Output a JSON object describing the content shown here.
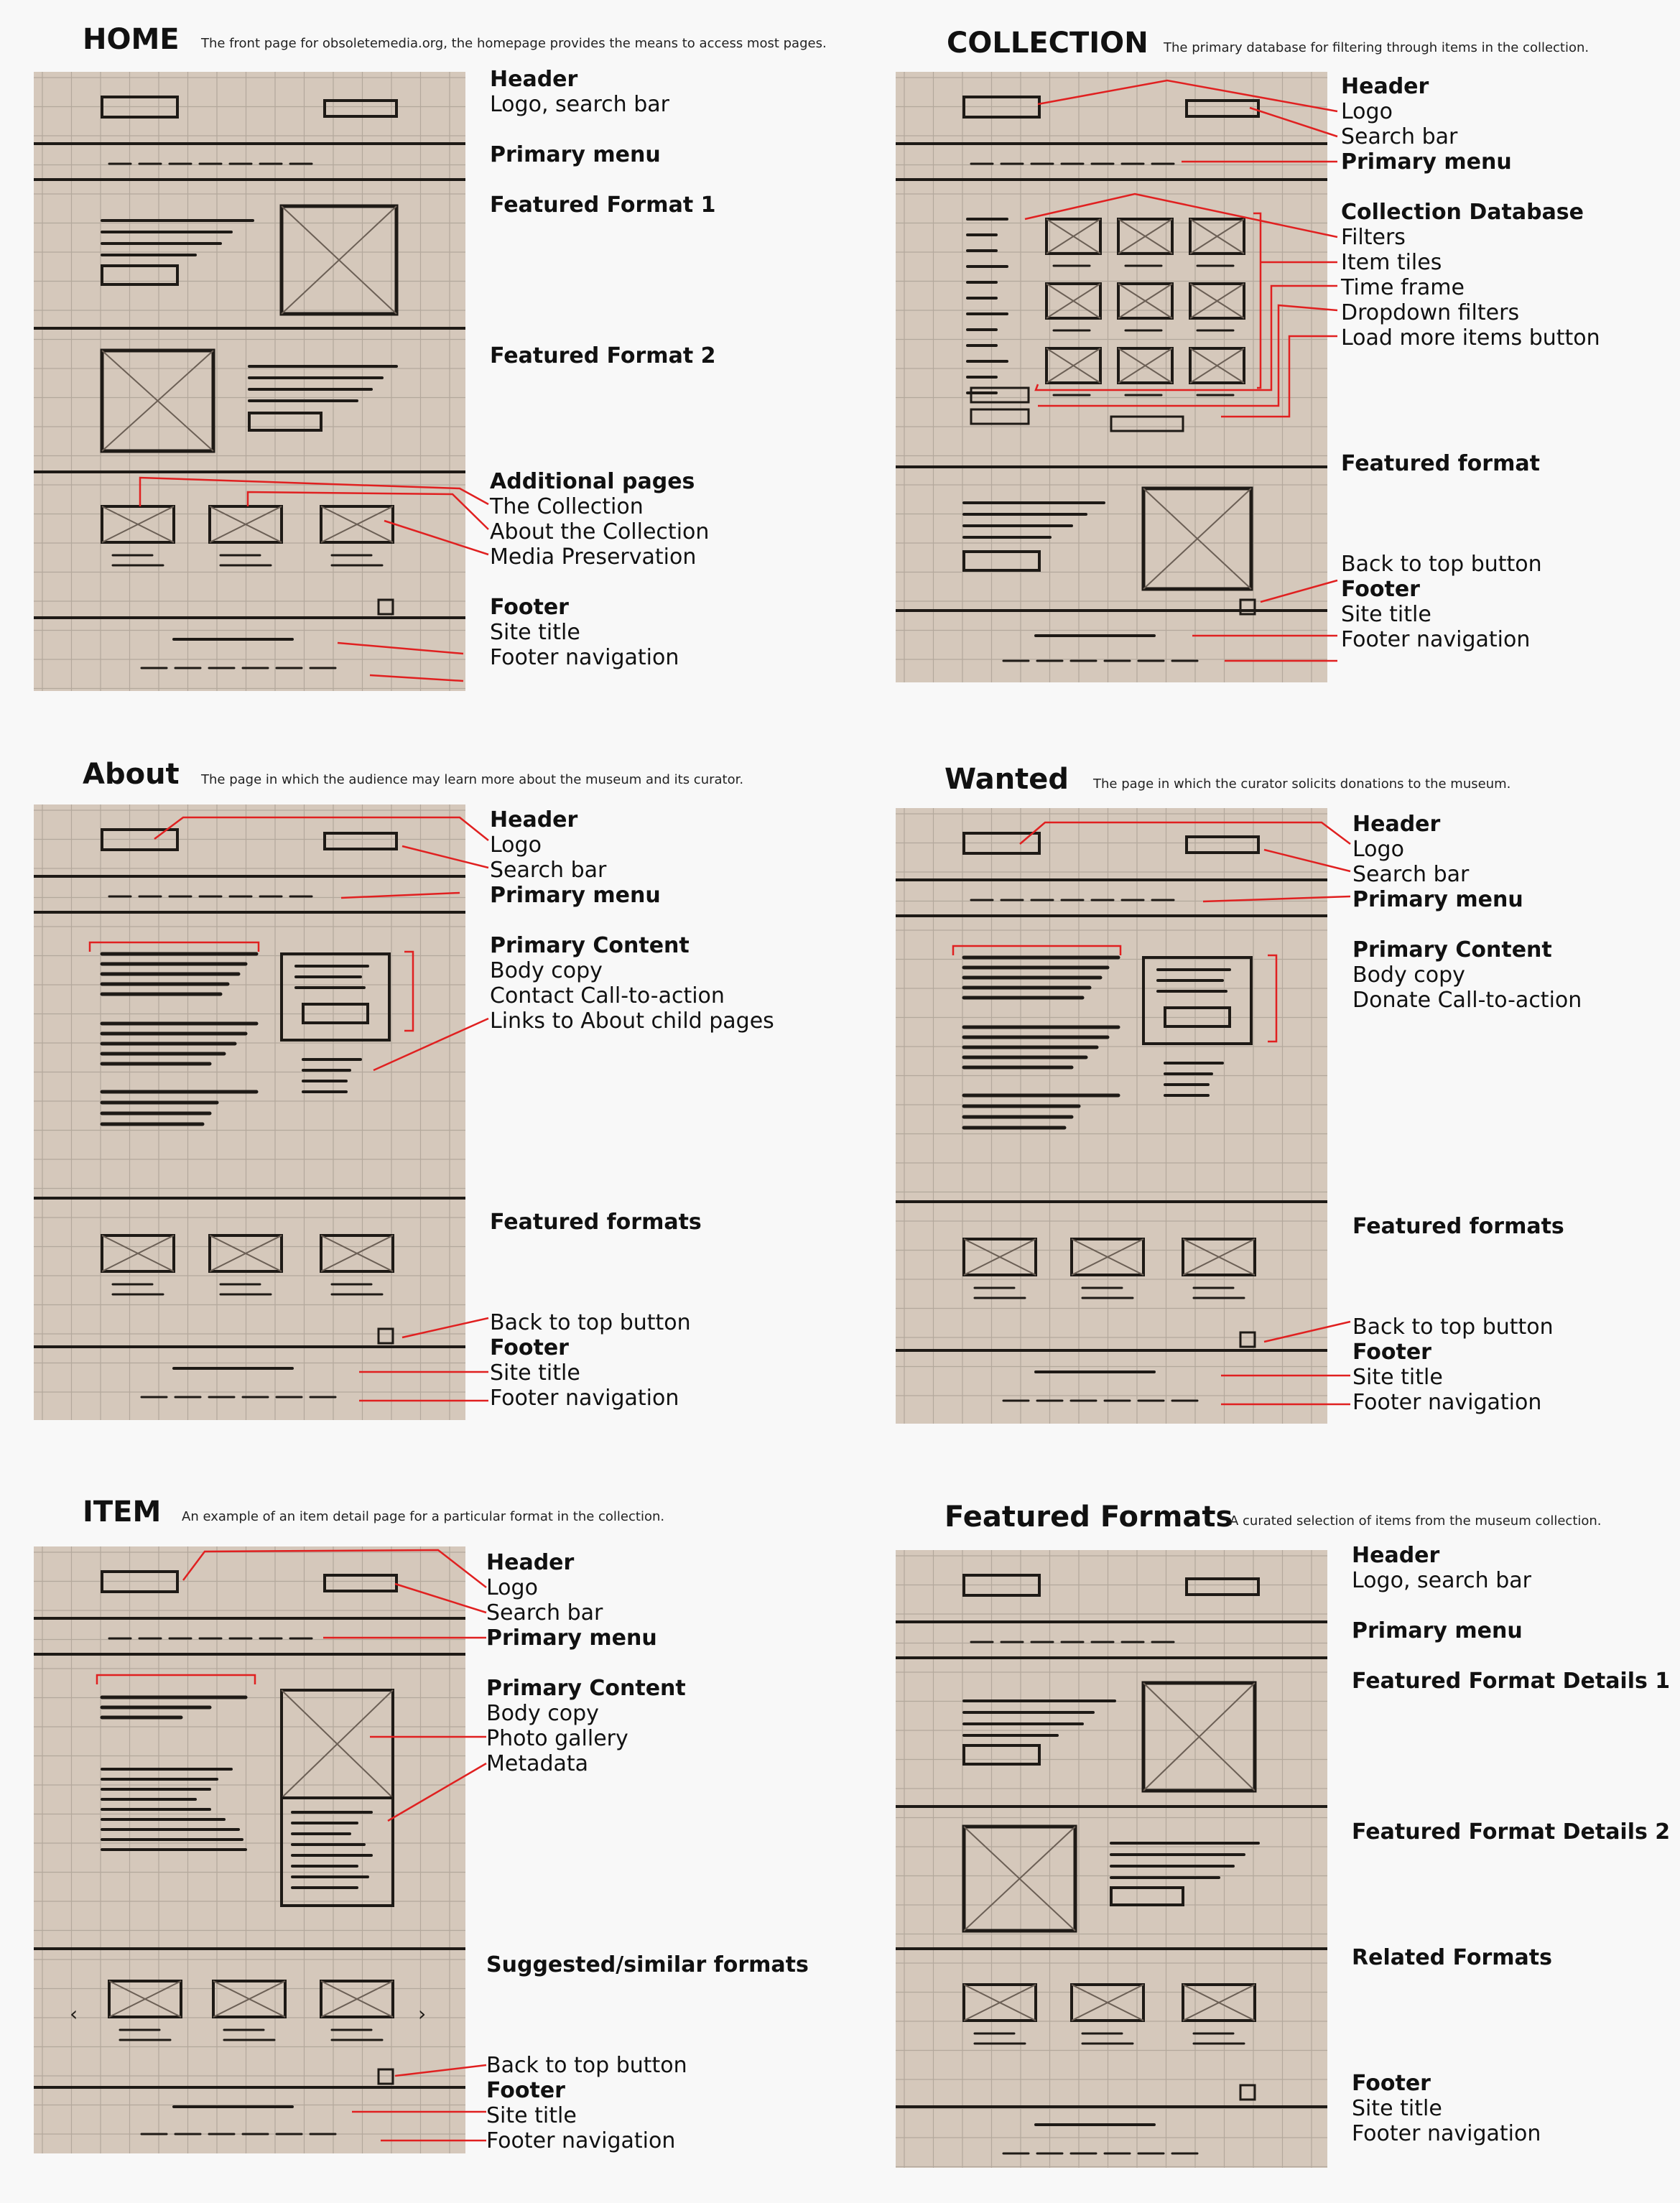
{
  "panels": [
    {
      "key": "home",
      "title": "HOME",
      "description": "The front page for obsoletemedia.org, the homepage provides the means to access most pages.",
      "labels": [
        {
          "text": "Header",
          "bold": true
        },
        {
          "text": "Logo, search bar",
          "bold": false
        },
        {
          "text": "",
          "bold": false
        },
        {
          "text": "Primary menu",
          "bold": true
        },
        {
          "text": "",
          "bold": false
        },
        {
          "text": "Featured Format 1",
          "bold": true
        },
        {
          "text": "",
          "bold": false
        },
        {
          "text": "",
          "bold": false
        },
        {
          "text": "",
          "bold": false
        },
        {
          "text": "",
          "bold": false
        },
        {
          "text": "",
          "bold": false
        },
        {
          "text": "Featured Format 2",
          "bold": true
        },
        {
          "text": "",
          "bold": false
        },
        {
          "text": "",
          "bold": false
        },
        {
          "text": "",
          "bold": false
        },
        {
          "text": "",
          "bold": false
        },
        {
          "text": "Additional pages",
          "bold": true
        },
        {
          "text": "The Collection",
          "bold": false
        },
        {
          "text": "About the Collection",
          "bold": false
        },
        {
          "text": "Media Preservation",
          "bold": false
        },
        {
          "text": "",
          "bold": false
        },
        {
          "text": "Footer",
          "bold": true
        },
        {
          "text": "Site title",
          "bold": false
        },
        {
          "text": "Footer navigation",
          "bold": false
        }
      ]
    },
    {
      "key": "collection",
      "title": "COLLECTION",
      "description": "The primary database for filtering through items in the collection.",
      "labels": [
        {
          "text": "Header",
          "bold": true
        },
        {
          "text": "Logo",
          "bold": false
        },
        {
          "text": "Search bar",
          "bold": false
        },
        {
          "text": "Primary menu",
          "bold": true
        },
        {
          "text": "",
          "bold": false
        },
        {
          "text": "Collection Database",
          "bold": true
        },
        {
          "text": "Filters",
          "bold": false
        },
        {
          "text": "Item tiles",
          "bold": false
        },
        {
          "text": "Time frame",
          "bold": false
        },
        {
          "text": "Dropdown filters",
          "bold": false
        },
        {
          "text": "Load more items button",
          "bold": false
        },
        {
          "text": "",
          "bold": false
        },
        {
          "text": "",
          "bold": false
        },
        {
          "text": "",
          "bold": false
        },
        {
          "text": "",
          "bold": false
        },
        {
          "text": "Featured format",
          "bold": true
        },
        {
          "text": "",
          "bold": false
        },
        {
          "text": "",
          "bold": false
        },
        {
          "text": "",
          "bold": false
        },
        {
          "text": "Back to top button",
          "bold": false
        },
        {
          "text": "Footer",
          "bold": true
        },
        {
          "text": "Site title",
          "bold": false
        },
        {
          "text": "Footer navigation",
          "bold": false
        }
      ]
    },
    {
      "key": "about",
      "title": "About",
      "description": "The page in which the audience may learn more about the museum and its curator.",
      "labels": [
        {
          "text": "Header",
          "bold": true
        },
        {
          "text": "Logo",
          "bold": false
        },
        {
          "text": "Search bar",
          "bold": false
        },
        {
          "text": "Primary menu",
          "bold": true
        },
        {
          "text": "",
          "bold": false
        },
        {
          "text": "Primary Content",
          "bold": true
        },
        {
          "text": "Body copy",
          "bold": false
        },
        {
          "text": "Contact Call-to-action",
          "bold": false
        },
        {
          "text": "Links to About child pages",
          "bold": false
        },
        {
          "text": "",
          "bold": false
        },
        {
          "text": "",
          "bold": false
        },
        {
          "text": "",
          "bold": false
        },
        {
          "text": "",
          "bold": false
        },
        {
          "text": "",
          "bold": false
        },
        {
          "text": "",
          "bold": false
        },
        {
          "text": "",
          "bold": false
        },
        {
          "text": "Featured formats",
          "bold": true
        },
        {
          "text": "",
          "bold": false
        },
        {
          "text": "",
          "bold": false
        },
        {
          "text": "",
          "bold": false
        },
        {
          "text": "Back to top button",
          "bold": false
        },
        {
          "text": "Footer",
          "bold": true
        },
        {
          "text": "Site title",
          "bold": false
        },
        {
          "text": "Footer navigation",
          "bold": false
        }
      ]
    },
    {
      "key": "wanted",
      "title": "Wanted",
      "description": "The page in which the curator solicits donations to the museum.",
      "labels": [
        {
          "text": "Header",
          "bold": true
        },
        {
          "text": "Logo",
          "bold": false
        },
        {
          "text": "Search bar",
          "bold": false
        },
        {
          "text": "Primary menu",
          "bold": true
        },
        {
          "text": "",
          "bold": false
        },
        {
          "text": "Primary Content",
          "bold": true
        },
        {
          "text": "Body copy",
          "bold": false
        },
        {
          "text": "Donate Call-to-action",
          "bold": false
        },
        {
          "text": "",
          "bold": false
        },
        {
          "text": "",
          "bold": false
        },
        {
          "text": "",
          "bold": false
        },
        {
          "text": "",
          "bold": false
        },
        {
          "text": "",
          "bold": false
        },
        {
          "text": "",
          "bold": false
        },
        {
          "text": "",
          "bold": false
        },
        {
          "text": "",
          "bold": false
        },
        {
          "text": "Featured formats",
          "bold": true
        },
        {
          "text": "",
          "bold": false
        },
        {
          "text": "",
          "bold": false
        },
        {
          "text": "",
          "bold": false
        },
        {
          "text": "Back to top button",
          "bold": false
        },
        {
          "text": "Footer",
          "bold": true
        },
        {
          "text": "Site title",
          "bold": false
        },
        {
          "text": "Footer navigation",
          "bold": false
        }
      ]
    },
    {
      "key": "item",
      "title": "ITEM",
      "description": "An example of an item detail page for a particular format in the collection.",
      "labels": [
        {
          "text": "Header",
          "bold": true
        },
        {
          "text": "Logo",
          "bold": false
        },
        {
          "text": "Search bar",
          "bold": false
        },
        {
          "text": "Primary menu",
          "bold": true
        },
        {
          "text": "",
          "bold": false
        },
        {
          "text": "Primary Content",
          "bold": true
        },
        {
          "text": "Body copy",
          "bold": false
        },
        {
          "text": "Photo gallery",
          "bold": false
        },
        {
          "text": "Metadata",
          "bold": false
        },
        {
          "text": "",
          "bold": false
        },
        {
          "text": "",
          "bold": false
        },
        {
          "text": "",
          "bold": false
        },
        {
          "text": "",
          "bold": false
        },
        {
          "text": "",
          "bold": false
        },
        {
          "text": "",
          "bold": false
        },
        {
          "text": "",
          "bold": false
        },
        {
          "text": "Suggested/similar formats",
          "bold": true
        },
        {
          "text": "",
          "bold": false
        },
        {
          "text": "",
          "bold": false
        },
        {
          "text": "",
          "bold": false
        },
        {
          "text": "Back to top button",
          "bold": false
        },
        {
          "text": "Footer",
          "bold": true
        },
        {
          "text": "Site title",
          "bold": false
        },
        {
          "text": "Footer navigation",
          "bold": false
        }
      ]
    },
    {
      "key": "featured",
      "title": "Featured Formats",
      "description": "A curated selection of items from the museum collection.",
      "labels": [
        {
          "text": "Header",
          "bold": true
        },
        {
          "text": "Logo, search bar",
          "bold": false
        },
        {
          "text": "",
          "bold": false
        },
        {
          "text": "Primary menu",
          "bold": true
        },
        {
          "text": "",
          "bold": false
        },
        {
          "text": "Featured Format Details 1",
          "bold": true
        },
        {
          "text": "",
          "bold": false
        },
        {
          "text": "",
          "bold": false
        },
        {
          "text": "",
          "bold": false
        },
        {
          "text": "",
          "bold": false
        },
        {
          "text": "",
          "bold": false
        },
        {
          "text": "Featured Format Details 2",
          "bold": true
        },
        {
          "text": "",
          "bold": false
        },
        {
          "text": "",
          "bold": false
        },
        {
          "text": "",
          "bold": false
        },
        {
          "text": "",
          "bold": false
        },
        {
          "text": "Related Formats",
          "bold": true
        },
        {
          "text": "",
          "bold": false
        },
        {
          "text": "",
          "bold": false
        },
        {
          "text": "",
          "bold": false
        },
        {
          "text": "",
          "bold": false
        },
        {
          "text": "Footer",
          "bold": true
        },
        {
          "text": "Site title",
          "bold": false
        },
        {
          "text": "Footer navigation",
          "bold": false
        }
      ]
    }
  ],
  "colors": {
    "paper": "#d5c8bb",
    "grid": "#b3a89c",
    "ink": "#1e1a16",
    "annotation": "#e02020",
    "background": "#f8f8f8"
  }
}
